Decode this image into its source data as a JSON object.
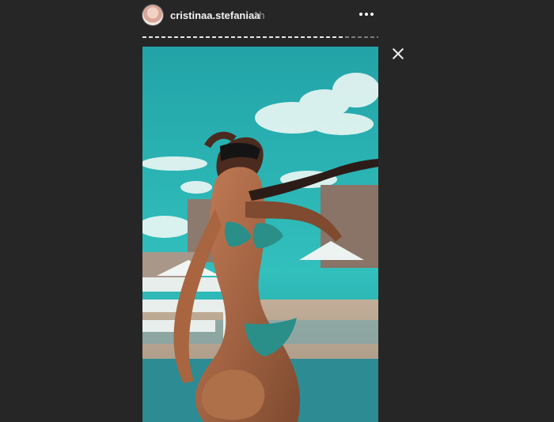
{
  "story": {
    "username": "cristinaa.stefaniaa",
    "time": "1h"
  }
}
